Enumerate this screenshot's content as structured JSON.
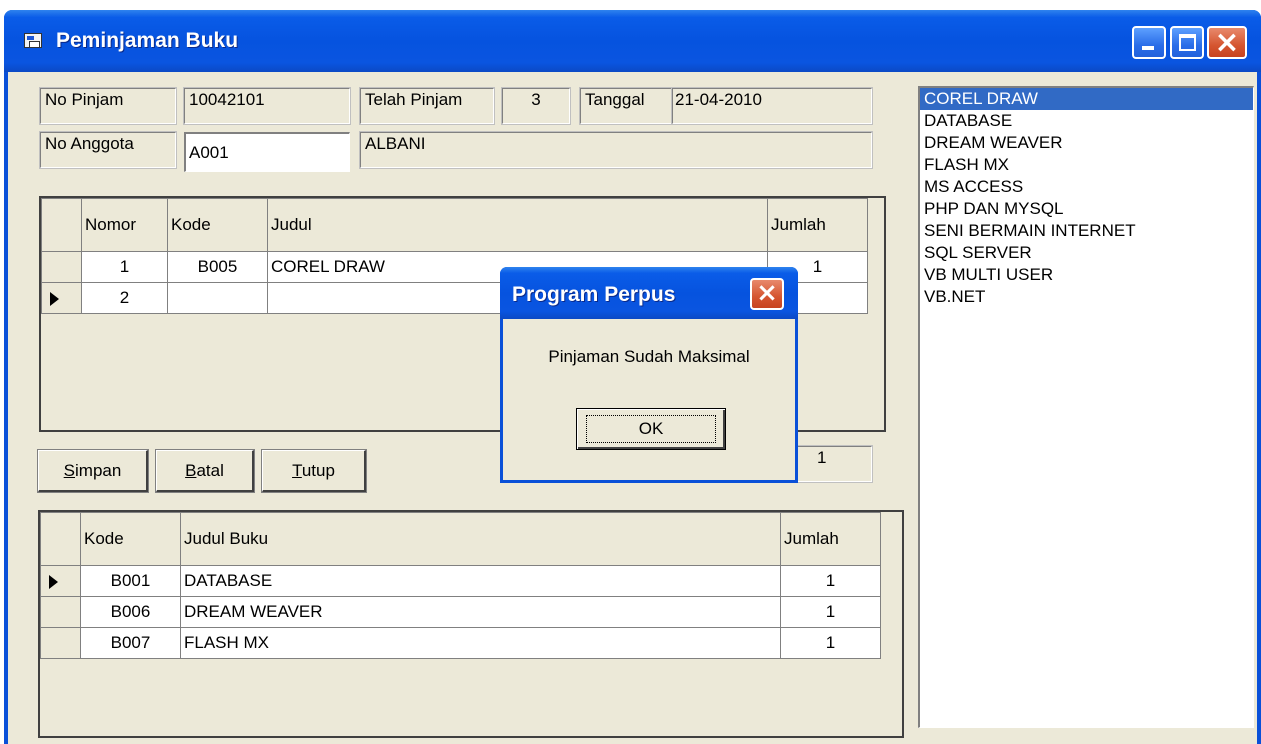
{
  "window": {
    "title": "Peminjaman Buku"
  },
  "form": {
    "no_pinjam_label": "No Pinjam",
    "no_pinjam_value": "10042101",
    "telah_pinjam_label": "Telah Pinjam",
    "telah_pinjam_value": "3",
    "tanggal_label": "Tanggal",
    "tanggal_value": "21-04-2010",
    "no_anggota_label": "No Anggota",
    "no_anggota_value": "A001",
    "nama_anggota": "ALBANI",
    "total_value": "1"
  },
  "loan_grid": {
    "headers": [
      "Nomor",
      "Kode",
      "Judul",
      "Jumlah"
    ],
    "rows": [
      {
        "nomor": "1",
        "kode": "B005",
        "judul": "COREL DRAW",
        "jumlah": "1"
      },
      {
        "nomor": "2",
        "kode": "",
        "judul": "",
        "jumlah": ""
      }
    ]
  },
  "buttons": {
    "simpan_hot": "S",
    "simpan_rest": "impan",
    "batal_hot": "B",
    "batal_rest": "atal",
    "tutup_hot": "T",
    "tutup_rest": "utup"
  },
  "borrowed_grid": {
    "headers": [
      "Kode",
      "Judul Buku",
      "Jumlah"
    ],
    "rows": [
      {
        "kode": "B001",
        "judul": "DATABASE",
        "jumlah": "1"
      },
      {
        "kode": "B006",
        "judul": "DREAM WEAVER",
        "jumlah": "1"
      },
      {
        "kode": "B007",
        "judul": "FLASH MX",
        "jumlah": "1"
      }
    ]
  },
  "book_list": {
    "items": [
      "COREL DRAW",
      "DATABASE",
      "DREAM WEAVER",
      "FLASH MX",
      "MS ACCESS",
      "PHP DAN MYSQL",
      "SENI BERMAIN INTERNET",
      "SQL SERVER",
      "VB MULTI USER",
      "VB.NET"
    ],
    "selected": "COREL DRAW"
  },
  "dialog": {
    "title": "Program Perpus",
    "message": "Pinjaman Sudah Maksimal",
    "ok_label": "OK"
  },
  "colors": {
    "titlebar": "#0653df",
    "face": "#ece9d8",
    "selection": "#316ac5",
    "close_button": "#d55530"
  }
}
